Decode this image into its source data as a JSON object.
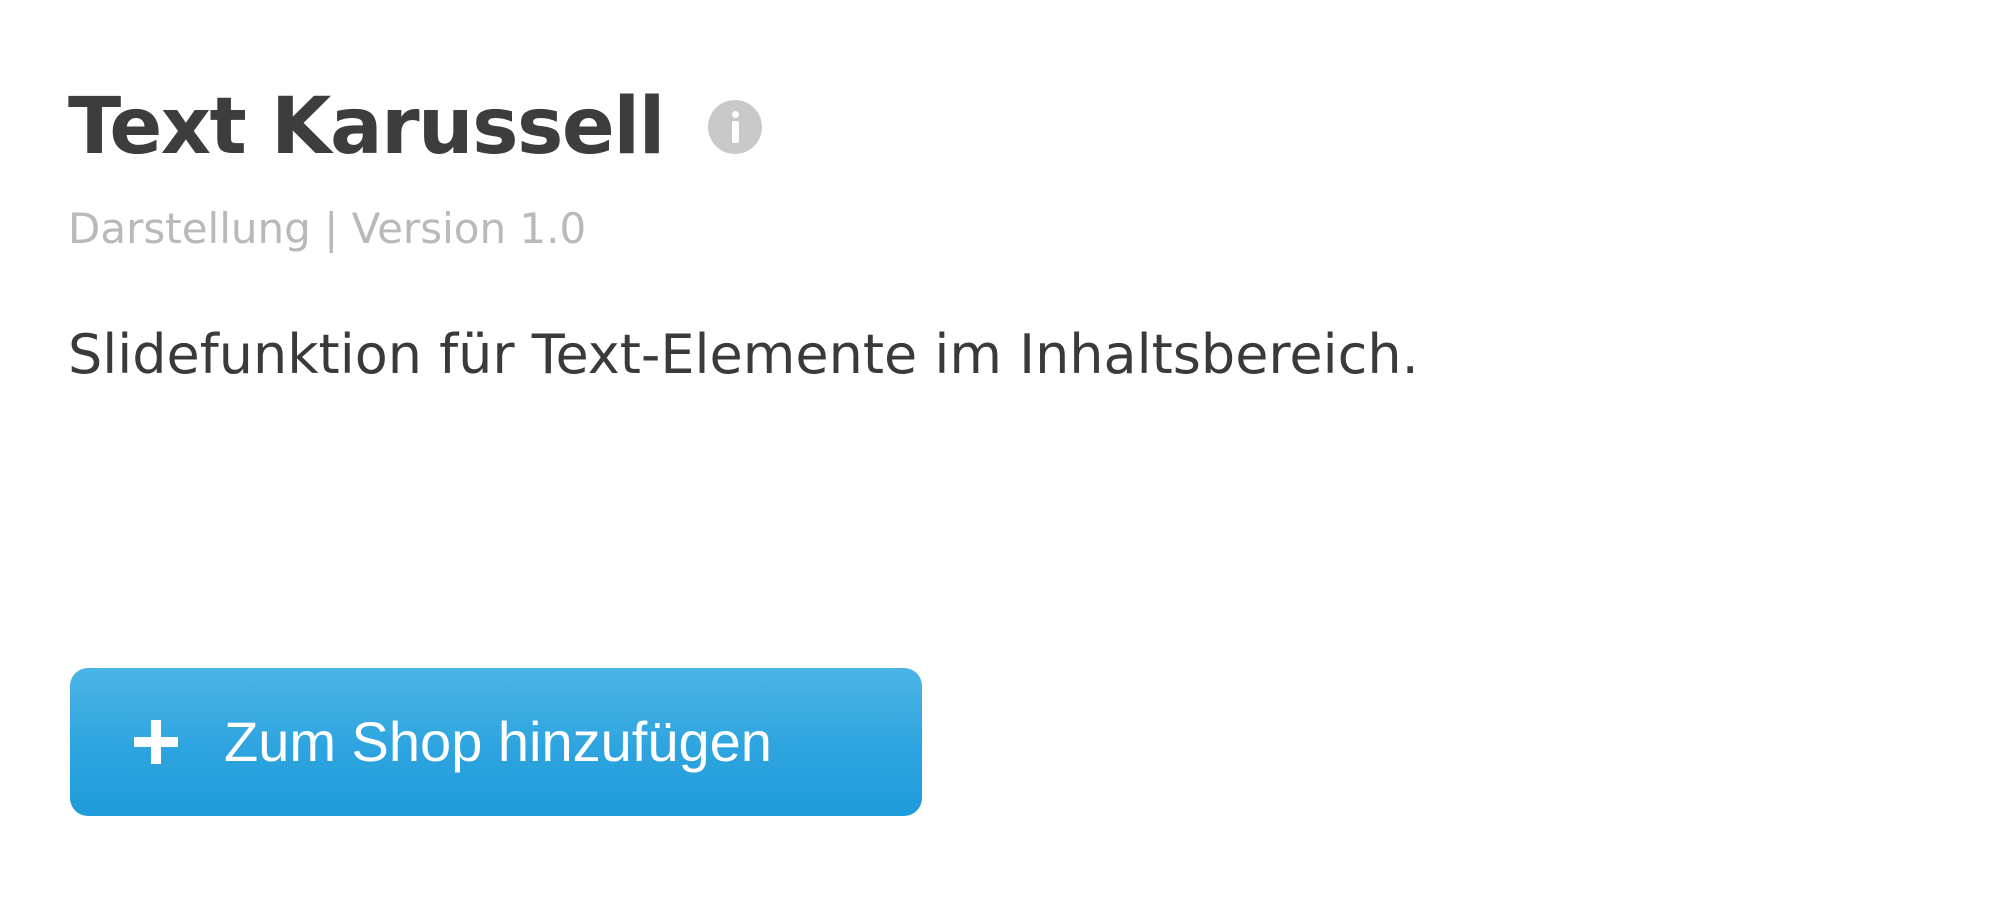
{
  "plugin": {
    "title": "Text Karussell",
    "meta": "Darstellung | Version 1.0",
    "description": "Slidefunktion für Text-Elemente im Inhaltsbereich.",
    "info_icon": "info-circle-icon"
  },
  "actions": {
    "add_label": "Zum Shop hinzufügen",
    "add_icon": "plus-icon",
    "accent_color": "#2da4df"
  }
}
